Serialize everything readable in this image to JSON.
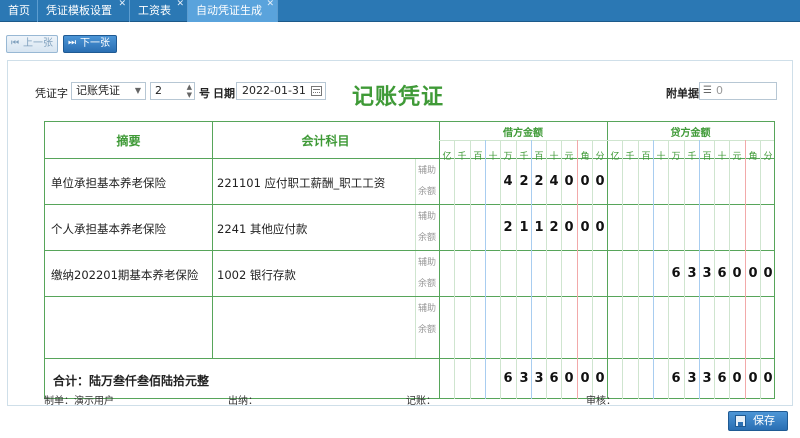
{
  "tabs": [
    {
      "label": "首页",
      "closable": false,
      "active": false
    },
    {
      "label": "凭证模板设置",
      "closable": true,
      "active": false
    },
    {
      "label": "工资表",
      "closable": true,
      "active": false
    },
    {
      "label": "自动凭证生成",
      "closable": true,
      "active": true
    }
  ],
  "toolbar": {
    "prev_label": "上一张",
    "next_label": "下一张"
  },
  "voucher": {
    "title": "记账凭证",
    "word_label": "凭证字",
    "word_value": "记账凭证",
    "number": "2",
    "number_label": "号",
    "date_label": "日期",
    "date_value": "2022-01-31",
    "attach_label": "附单据",
    "attach_value": "0"
  },
  "grid": {
    "col_summary": "摘要",
    "col_account": "会计科目",
    "col_debit": "借方金额",
    "col_credit": "贷方金额",
    "digit_units": [
      "亿",
      "千",
      "百",
      "十",
      "万",
      "千",
      "百",
      "十",
      "元",
      "角",
      "分"
    ],
    "aux_label": "辅助",
    "balance_label": "余额",
    "rows": [
      {
        "summary": "单位承担基本养老保险",
        "account": "221101 应付职工薪酬_职工工资",
        "debit": [
          "",
          "",
          "",
          "4",
          "2",
          "2",
          "4",
          "0",
          "0",
          "0",
          ""
        ],
        "credit": [
          "",
          "",
          "",
          "",
          "",
          "",
          "",
          "",
          "",
          "",
          ""
        ]
      },
      {
        "summary": "个人承担基本养老保险",
        "account": "2241 其他应付款",
        "debit": [
          "",
          "",
          "",
          "2",
          "1",
          "1",
          "2",
          "0",
          "0",
          "0",
          ""
        ],
        "credit": [
          "",
          "",
          "",
          "",
          "",
          "",
          "",
          "",
          "",
          "",
          ""
        ]
      },
      {
        "summary": "缴纳202201期基本养老保险",
        "account": "1002 银行存款",
        "debit": [
          "",
          "",
          "",
          "",
          "",
          "",
          "",
          "",
          "",
          "",
          ""
        ],
        "credit": [
          "",
          "",
          "",
          "6",
          "3",
          "3",
          "6",
          "0",
          "0",
          "0",
          ""
        ]
      },
      {
        "summary": "",
        "account": "",
        "debit": [
          "",
          "",
          "",
          "",
          "",
          "",
          "",
          "",
          "",
          "",
          ""
        ],
        "credit": [
          "",
          "",
          "",
          "",
          "",
          "",
          "",
          "",
          "",
          "",
          ""
        ]
      }
    ],
    "total_label": "合计：陆万叁仟叁佰陆拾元整",
    "total_debit": [
      "",
      "",
      "",
      "6",
      "3",
      "3",
      "6",
      "0",
      "0",
      "0",
      ""
    ],
    "total_credit": [
      "",
      "",
      "",
      "6",
      "3",
      "3",
      "6",
      "0",
      "0",
      "0",
      ""
    ]
  },
  "footer": {
    "maker_label": "制单：演示用户",
    "cashier_label": "出纳：",
    "bookkeeper_label": "记账：",
    "auditor_label": "审核："
  },
  "save_label": "保存",
  "colors": {
    "tab_bar": "#2b78b4",
    "tab_active": "#5aa3dc",
    "grid_green": "#57a55a",
    "title_green": "#3f9a37",
    "button_blue": "#2a6fb3"
  }
}
